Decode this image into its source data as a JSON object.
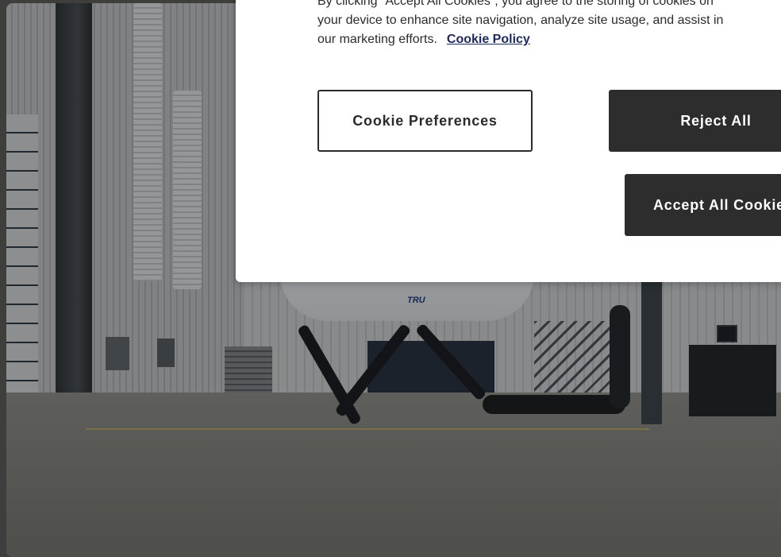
{
  "cookie_banner": {
    "text_line_1": "By clicking “Accept All Cookies”, you agree to the storing of cookies on",
    "text_line_2": "your device to enhance site navigation, analyze site usage, and assist in",
    "text_line_3": "our marketing efforts.",
    "policy_link_label": "Cookie Policy",
    "buttons": {
      "preferences_label": "Cookie Preferences",
      "reject_label": "Reject All",
      "accept_label": "Accept All Cookies"
    }
  },
  "background": {
    "simulator_logo": "TRU"
  },
  "colors": {
    "button_dark": "#2d2d2d",
    "link": "#1c2a5e",
    "dialog_bg": "#ffffff",
    "overlay": "rgba(0,0,0,0.30)"
  }
}
